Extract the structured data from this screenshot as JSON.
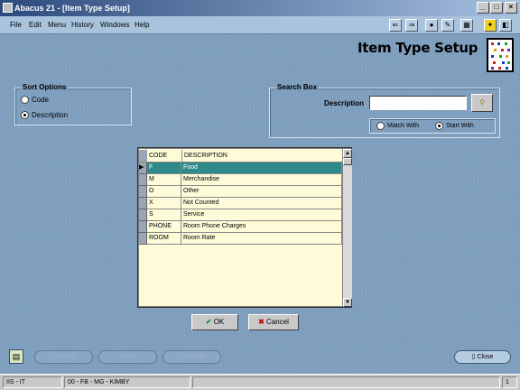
{
  "window": {
    "title": "Abacus 21 - [Item Type Setup]",
    "min": "_",
    "max": "□",
    "close": "×"
  },
  "menu": [
    "File",
    "Edit",
    "Menu",
    "History",
    "Windows",
    "Help"
  ],
  "heading": "Item Type Setup",
  "sort_options": {
    "legend": "Sort Options",
    "options": [
      {
        "label": "Code",
        "selected": false
      },
      {
        "label": "Description",
        "selected": true
      }
    ]
  },
  "search_box": {
    "legend": "Search Box",
    "label": "Description",
    "value": "",
    "match_with": "Match With",
    "start_with": "Start With",
    "selected": "Start With"
  },
  "table": {
    "columns": [
      "CODE",
      "DESCRIPTION"
    ],
    "rows": [
      {
        "code": "F",
        "description": "Food",
        "selected": true
      },
      {
        "code": "M",
        "description": "Merchandise",
        "selected": false
      },
      {
        "code": "O",
        "description": "Other",
        "selected": false
      },
      {
        "code": "X",
        "description": "Not Counted",
        "selected": false
      },
      {
        "code": "S",
        "description": "Service",
        "selected": false
      },
      {
        "code": "PHONE",
        "description": "Room Phone Charges",
        "selected": false
      },
      {
        "code": "ROOM",
        "description": "Room Rate",
        "selected": false
      }
    ]
  },
  "dialog_buttons": {
    "ok": "OK",
    "cancel": "Cancel"
  },
  "bottom_buttons": {
    "save": "Save",
    "undo": "Undo",
    "delete": "Delete",
    "close": "Close"
  },
  "status": {
    "left": "IIS - IT",
    "middle": "00 - FB - MG - KIMBY",
    "right": "1"
  }
}
